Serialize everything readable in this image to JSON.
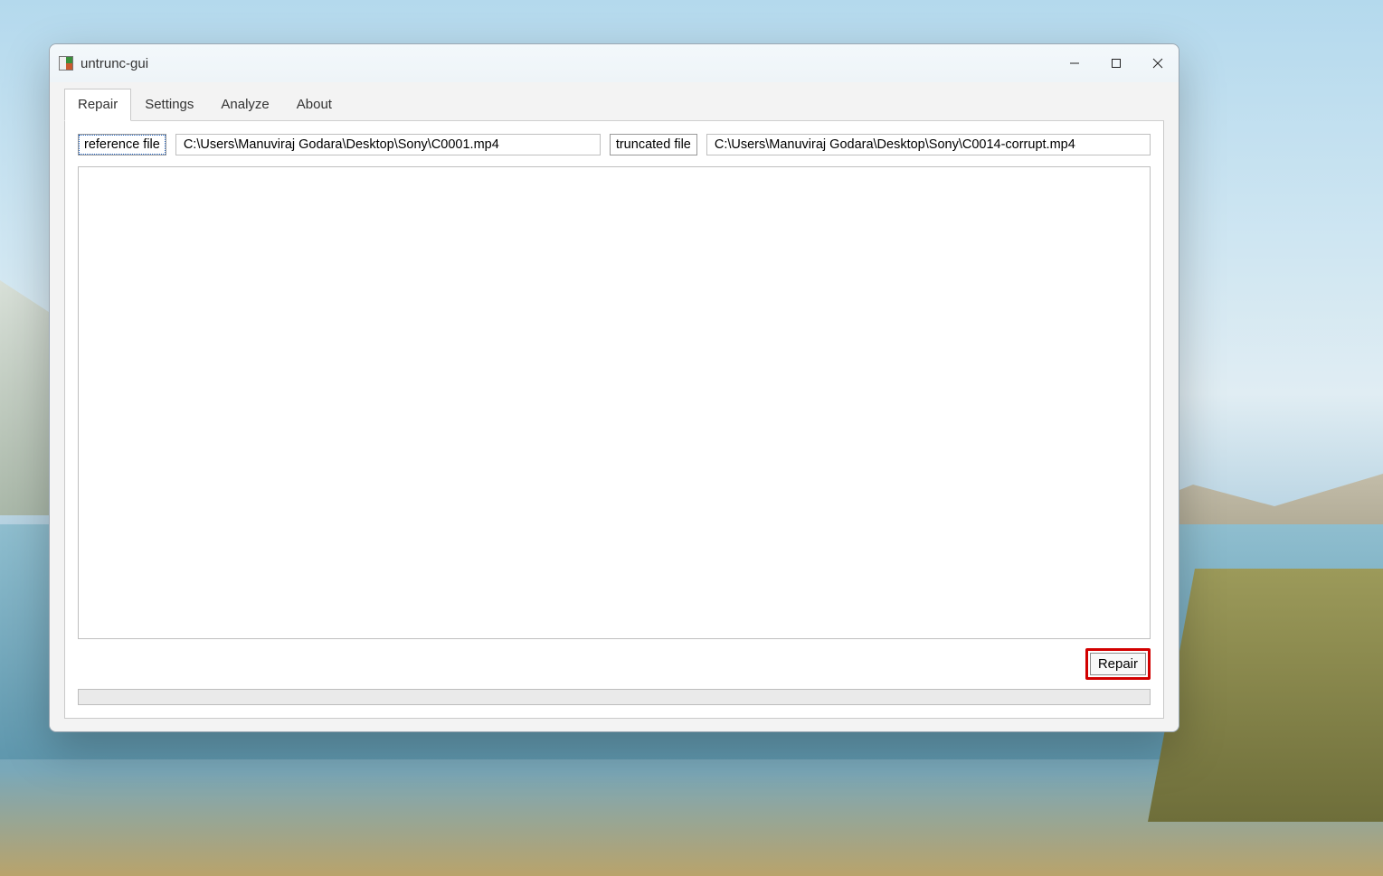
{
  "window": {
    "title": "untrunc-gui"
  },
  "tabs": [
    {
      "label": "Repair",
      "active": true
    },
    {
      "label": "Settings",
      "active": false
    },
    {
      "label": "Analyze",
      "active": false
    },
    {
      "label": "About",
      "active": false
    }
  ],
  "repair_tab": {
    "reference_button_label": "reference file",
    "reference_path": "C:\\Users\\Manuviraj Godara\\Desktop\\Sony\\C0001.mp4",
    "truncated_button_label": "truncated file",
    "truncated_path": "C:\\Users\\Manuviraj Godara\\Desktop\\Sony\\C0014-corrupt.mp4",
    "log_text": "",
    "repair_button_label": "Repair"
  }
}
